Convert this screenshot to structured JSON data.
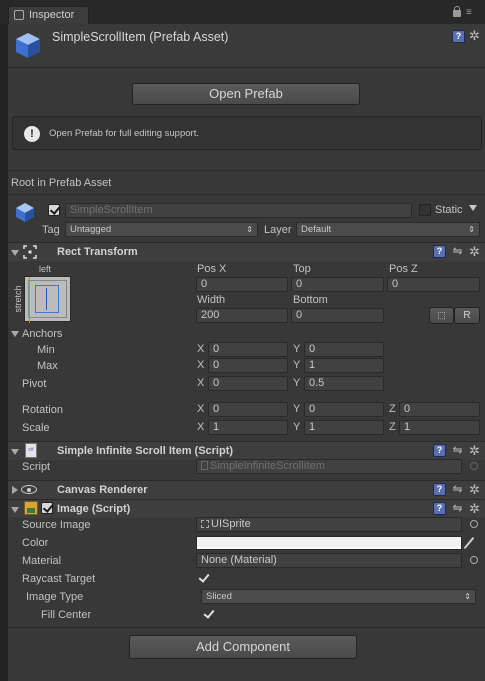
{
  "tab": {
    "title": "Inspector"
  },
  "header": {
    "title": "SimpleScrollItem (Prefab Asset)"
  },
  "open_prefab_button": "Open Prefab",
  "info_box": {
    "text": "Open Prefab for full editing support."
  },
  "root_label": "Root in Prefab Asset",
  "gameobject": {
    "name": "SimpleScrollItem",
    "static_label": "Static",
    "tag_label": "Tag",
    "tag_value": "Untagged",
    "layer_label": "Layer",
    "layer_value": "Default"
  },
  "rect_transform": {
    "title": "Rect Transform",
    "anchor_preset_h": "left",
    "anchor_preset_v": "stretch",
    "posx_label": "Pos X",
    "posx_value": "0",
    "top_label": "Top",
    "top_value": "0",
    "posz_label": "Pos Z",
    "posz_value": "0",
    "width_label": "Width",
    "width_value": "200",
    "bottom_label": "Bottom",
    "bottom_value": "0",
    "r_button": "R",
    "anchors_label": "Anchors",
    "min_label": "Min",
    "min_x": "0",
    "min_y": "0",
    "max_label": "Max",
    "max_x": "0",
    "max_y": "1",
    "pivot_label": "Pivot",
    "pivot_x": "0",
    "pivot_y": "0.5",
    "rotation_label": "Rotation",
    "rot_x": "0",
    "rot_y": "0",
    "rot_z": "0",
    "scale_label": "Scale",
    "scale_x": "1",
    "scale_y": "1",
    "scale_z": "1",
    "x": "X",
    "y": "Y",
    "z": "Z"
  },
  "script_component": {
    "title": "Simple Infinite Scroll Item (Script)",
    "script_label": "Script",
    "script_value": "SimpleInfiniteScrollItem"
  },
  "canvas_renderer": {
    "title": "Canvas Renderer"
  },
  "image": {
    "title": "Image (Script)",
    "source_image_label": "Source Image",
    "source_image_value": "UISprite",
    "color_label": "Color",
    "color_value": "#f2f2f2",
    "material_label": "Material",
    "material_value": "None (Material)",
    "raycast_label": "Raycast Target",
    "image_type_label": "Image Type",
    "image_type_value": "Sliced",
    "fill_center_label": "Fill Center"
  },
  "add_component_button": "Add Component",
  "icons": [
    "cube-icon",
    "help-icon",
    "preset-icon",
    "gear-icon",
    "lock-icon",
    "menu-icon",
    "rect-transform-icon",
    "script-icon",
    "eye-icon",
    "image-icon",
    "eyedropper-icon",
    "object-picker-icon"
  ]
}
